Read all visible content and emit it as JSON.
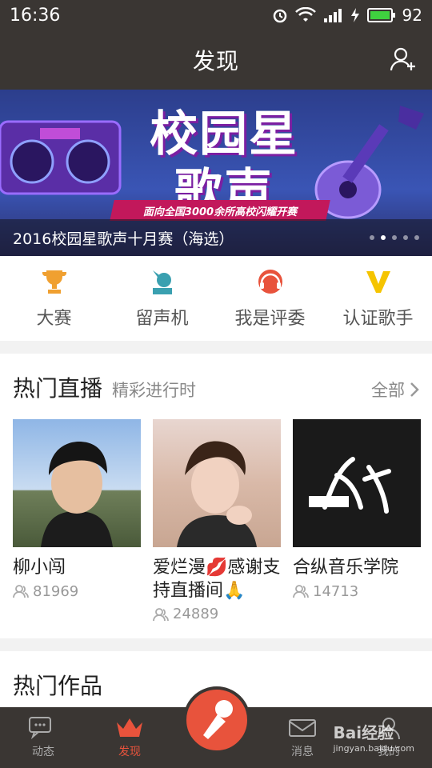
{
  "status_bar": {
    "time": "16:36",
    "battery": "92",
    "net": "3G"
  },
  "header": {
    "title": "发现",
    "add_user_icon": "add-user-icon"
  },
  "banner": {
    "big_text": "校园星歌声",
    "slogan": "面向全国3000余所高校闪耀开赛",
    "caption": "2016校园星歌声十月赛（海选）",
    "slides": 5,
    "active_slide": 2
  },
  "categories": [
    {
      "label": "大赛",
      "icon": "trophy-icon",
      "color": "#f0a030"
    },
    {
      "label": "留声机",
      "icon": "gramophone-icon",
      "color": "#3aa0b0"
    },
    {
      "label": "我是评委",
      "icon": "judge-headset-icon",
      "color": "#e8533c"
    },
    {
      "label": "认证歌手",
      "icon": "v-badge-icon",
      "color": "#f5c400"
    }
  ],
  "hot_live": {
    "title": "热门直播",
    "subtitle": "精彩进行时",
    "more": "全部",
    "cards": [
      {
        "name": "柳小闯",
        "viewers": "81969"
      },
      {
        "name": "爱烂漫💋感谢支持直播间🙏",
        "viewers": "24889"
      },
      {
        "name": "合纵音乐学院",
        "viewers": "14713"
      }
    ]
  },
  "hot_works": {
    "title": "热门作品"
  },
  "tabbar": {
    "tabs": [
      {
        "label": "动态"
      },
      {
        "label": "发现"
      },
      {
        "label": "消息"
      },
      {
        "label": "我的"
      }
    ],
    "active": 1
  },
  "colors": {
    "accent": "#e8533c",
    "bar": "#3a3633"
  },
  "watermark": {
    "text": "Bai经验",
    "url": "jingyan.baidu.com"
  }
}
